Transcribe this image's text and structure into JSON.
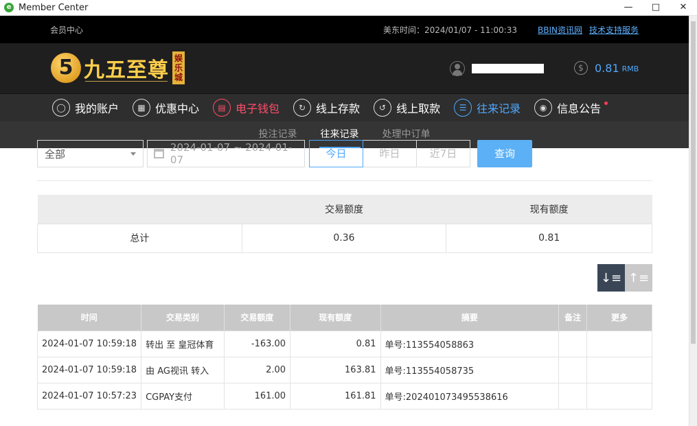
{
  "window": {
    "title": "Member Center",
    "icon_glyph": "e"
  },
  "topbar": {
    "member_center": "会员中心",
    "time": "美东时间：2024/01/07 - 11:00:33",
    "link1": "BBIN资讯网",
    "link2": "技术支持服务"
  },
  "logo": {
    "badge": "5",
    "brand": "九五至尊",
    "sub": "娱乐城"
  },
  "balance": {
    "amount": "0.81",
    "currency": "RMB",
    "coin_glyph": "$"
  },
  "nav": [
    {
      "label": "我的账户",
      "icon": "user-icon"
    },
    {
      "label": "优惠中心",
      "icon": "gift-icon"
    },
    {
      "label": "电子钱包",
      "icon": "wallet-icon"
    },
    {
      "label": "线上存款",
      "icon": "deposit-icon"
    },
    {
      "label": "线上取款",
      "icon": "withdraw-icon"
    },
    {
      "label": "往来记录",
      "icon": "records-icon"
    },
    {
      "label": "信息公告",
      "icon": "bell-icon"
    }
  ],
  "subnav": [
    "投注记录",
    "往来记录",
    "处理中订单"
  ],
  "filters": {
    "type": "全部",
    "daterange": "2024-01-07 ~ 2024-01-07",
    "seg": [
      "今日",
      "昨日",
      "近7日"
    ],
    "query": "查询"
  },
  "summary": {
    "headers": [
      "",
      "交易额度",
      "现有额度"
    ],
    "row": [
      "总计",
      "0.36",
      "0.81"
    ]
  },
  "records": {
    "headers": [
      "时间",
      "交易类别",
      "交易额度",
      "现有额度",
      "摘要",
      "备注",
      "更多"
    ],
    "rows": [
      [
        "2024-01-07 10:59:18",
        "转出 至 皇冠体育",
        "-163.00",
        "0.81",
        "单号:113554058863"
      ],
      [
        "2024-01-07 10:59:18",
        "由 AG视讯 转入",
        "2.00",
        "163.81",
        "单号:113554058735"
      ],
      [
        "2024-01-07 10:57:23",
        "CGPAY支付",
        "161.00",
        "161.81",
        "单号:202401073495538616"
      ]
    ]
  }
}
